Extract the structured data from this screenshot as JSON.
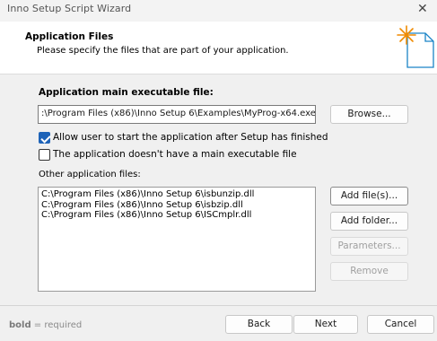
{
  "window": {
    "title": "Inno Setup Script Wizard",
    "close_glyph": "✕"
  },
  "header": {
    "title": "Application Files",
    "subtitle": "Please specify the files that are part of your application."
  },
  "main_exe": {
    "label": "Application main executable file:",
    "value": ":\\Program Files (x86)\\Inno Setup 6\\Examples\\MyProg-x64.exe",
    "browse_label": "Browse..."
  },
  "options": [
    {
      "label": "Allow user to start the application after Setup has finished",
      "checked": true
    },
    {
      "label": "The application doesn't have a main executable file",
      "checked": false
    }
  ],
  "other_files": {
    "label": "Other application files:",
    "items": [
      "C:\\Program Files (x86)\\Inno Setup 6\\isbunzip.dll",
      "C:\\Program Files (x86)\\Inno Setup 6\\isbzip.dll",
      "C:\\Program Files (x86)\\Inno Setup 6\\ISCmplr.dll"
    ]
  },
  "file_buttons": {
    "add_files": "Add file(s)...",
    "add_folder": "Add folder...",
    "parameters": "Parameters...",
    "remove": "Remove"
  },
  "footer": {
    "note_bold": "bold",
    "note_rest": " = required",
    "back": "Back",
    "next": "Next",
    "cancel": "Cancel"
  },
  "colors": {
    "accent": "#1e63b8",
    "wizard_icon_star": "#f08a00",
    "wizard_icon_outline": "#1a84c7"
  }
}
